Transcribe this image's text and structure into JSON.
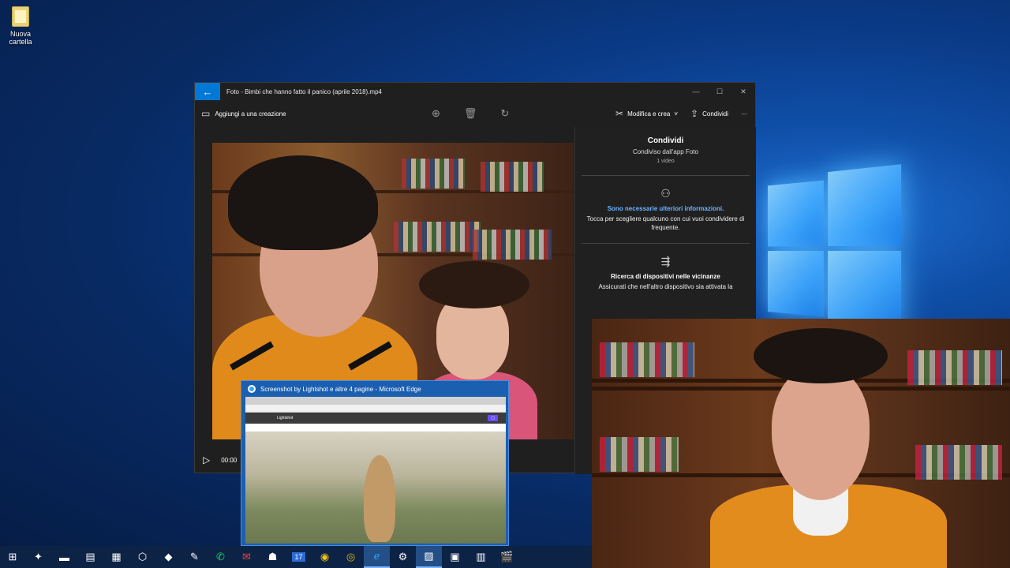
{
  "desktop": {
    "icon_label": "Nuova cartella"
  },
  "photos_window": {
    "title": "Foto - Bimbi che hanno fatto il panico (aprile 2018).mp4",
    "back_icon": "←",
    "minimize": "—",
    "maximize": "☐",
    "close": "✕",
    "toolbar": {
      "add_to_creation": "Aggiungi a una creazione",
      "edit_create": "Modifica e crea",
      "share": "Condividi",
      "more": "···"
    },
    "player": {
      "time": "00:00"
    }
  },
  "share_pane": {
    "title": "Condividi",
    "subtitle": "Condiviso dall'app Foto",
    "count": "1 video",
    "info_link": "Sono necessarie ulteriori informazioni.",
    "info_text": "Tocca per scegliere qualcuno con cui vuoi condividere di frequente.",
    "nearby_title": "Ricerca di dispositivi nelle vicinanze",
    "nearby_text": "Assicurati che nell'altro dispositivo sia attivata la"
  },
  "edge_preview": {
    "title": "Screenshot by Lightshot e altre 4 pagine - Microsoft Edge",
    "site_name": "Lightshot"
  },
  "taskbar": {
    "icons": [
      "windows-start",
      "app-shield",
      "terminal",
      "explorer",
      "remote-desktop",
      "virtualbox",
      "3d-box",
      "notepad-plus",
      "whatsapp",
      "gmail",
      "robot",
      "calendar",
      "keep",
      "chrome",
      "edge",
      "settings",
      "photos",
      "window-app",
      "media",
      "clapperboard"
    ],
    "calendar_day": "17"
  }
}
